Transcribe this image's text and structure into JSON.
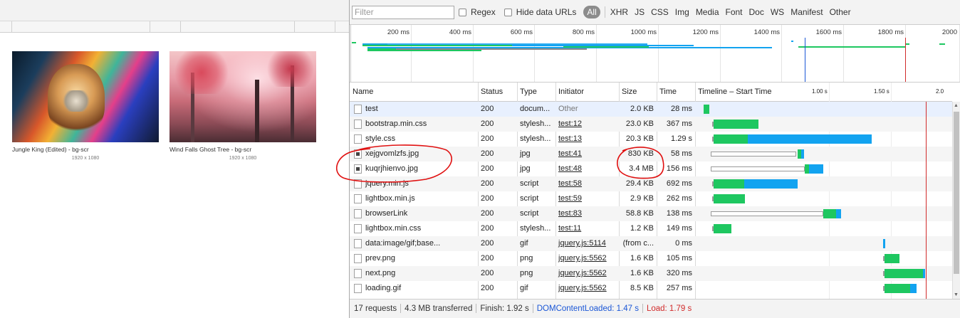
{
  "page": {
    "images": [
      {
        "caption": "Jungle King (Edited) - bg-scr",
        "dimensions": "1920 x 1080"
      },
      {
        "caption": "Wind Falls Ghost Tree - bg-scr",
        "dimensions": "1920 x 1080"
      }
    ]
  },
  "toolbar": {
    "filter_placeholder": "Filter",
    "regex_label": "Regex",
    "hide_data_urls_label": "Hide data URLs",
    "types": [
      "All",
      "XHR",
      "JS",
      "CSS",
      "Img",
      "Media",
      "Font",
      "Doc",
      "WS",
      "Manifest",
      "Other"
    ]
  },
  "overview": {
    "ticks": [
      "200 ms",
      "400 ms",
      "600 ms",
      "800 ms",
      "1000 ms",
      "1200 ms",
      "1400 ms",
      "1600 ms",
      "1800 ms",
      "2000"
    ]
  },
  "table": {
    "columns": {
      "name": "Name",
      "status": "Status",
      "type": "Type",
      "initiator": "Initiator",
      "size": "Size",
      "time": "Time",
      "timeline": "Timeline – Start Time",
      "t1": "1.00 s",
      "t2": "1.50 s",
      "t3": "2.0"
    },
    "rows": [
      {
        "name": "test",
        "status": "200",
        "type": "docum...",
        "initiator": "Other",
        "size": "2.0 KB",
        "time": "28 ms",
        "icon": "document-icon"
      },
      {
        "name": "bootstrap.min.css",
        "status": "200",
        "type": "stylesh...",
        "initiator": "test:12",
        "size": "23.0 KB",
        "time": "367 ms",
        "icon": "file-icon"
      },
      {
        "name": "style.css",
        "status": "200",
        "type": "stylesh...",
        "initiator": "test:13",
        "size": "20.3 KB",
        "time": "1.29 s",
        "icon": "file-icon"
      },
      {
        "name": "xejgvomlzfs.jpg",
        "status": "200",
        "type": "jpg",
        "initiator": "test:41",
        "size": "830 KB",
        "time": "58 ms",
        "icon": "image-icon"
      },
      {
        "name": "kuqrjhienvo.jpg",
        "status": "200",
        "type": "jpg",
        "initiator": "test:48",
        "size": "3.4 MB",
        "time": "156 ms",
        "icon": "image-icon"
      },
      {
        "name": "jquery.min.js",
        "status": "200",
        "type": "script",
        "initiator": "test:58",
        "size": "29.4 KB",
        "time": "692 ms",
        "icon": "file-icon"
      },
      {
        "name": "lightbox.min.js",
        "status": "200",
        "type": "script",
        "initiator": "test:59",
        "size": "2.9 KB",
        "time": "262 ms",
        "icon": "file-icon"
      },
      {
        "name": "browserLink",
        "status": "200",
        "type": "script",
        "initiator": "test:83",
        "size": "58.8 KB",
        "time": "138 ms",
        "icon": "file-icon"
      },
      {
        "name": "lightbox.min.css",
        "status": "200",
        "type": "stylesh...",
        "initiator": "test:11",
        "size": "1.2 KB",
        "time": "149 ms",
        "icon": "file-icon"
      },
      {
        "name": "data:image/gif;base...",
        "status": "200",
        "type": "gif",
        "initiator": "jquery.js:5114",
        "size": "(from c...",
        "time": "0 ms",
        "icon": "file-icon"
      },
      {
        "name": "prev.png",
        "status": "200",
        "type": "png",
        "initiator": "jquery.js:5562",
        "size": "1.6 KB",
        "time": "105 ms",
        "icon": "file-icon"
      },
      {
        "name": "next.png",
        "status": "200",
        "type": "png",
        "initiator": "jquery.js:5562",
        "size": "1.6 KB",
        "time": "320 ms",
        "icon": "file-icon"
      },
      {
        "name": "loading.gif",
        "status": "200",
        "type": "gif",
        "initiator": "jquery.js:5562",
        "size": "8.5 KB",
        "time": "257 ms",
        "icon": "file-icon"
      }
    ]
  },
  "status_bar": {
    "requests": "17 requests",
    "transferred": "4.3 MB transferred",
    "finish": "Finish: 1.92 s",
    "dom_content_loaded": "DOMContentLoaded: 1.47 s",
    "load": "Load: 1.79 s"
  },
  "colors": {
    "waiting": "#1ec760",
    "download": "#12a3f0",
    "dcl_line": "#1a56d6",
    "load_line": "#d12b2b",
    "annotation": "#e01010"
  }
}
